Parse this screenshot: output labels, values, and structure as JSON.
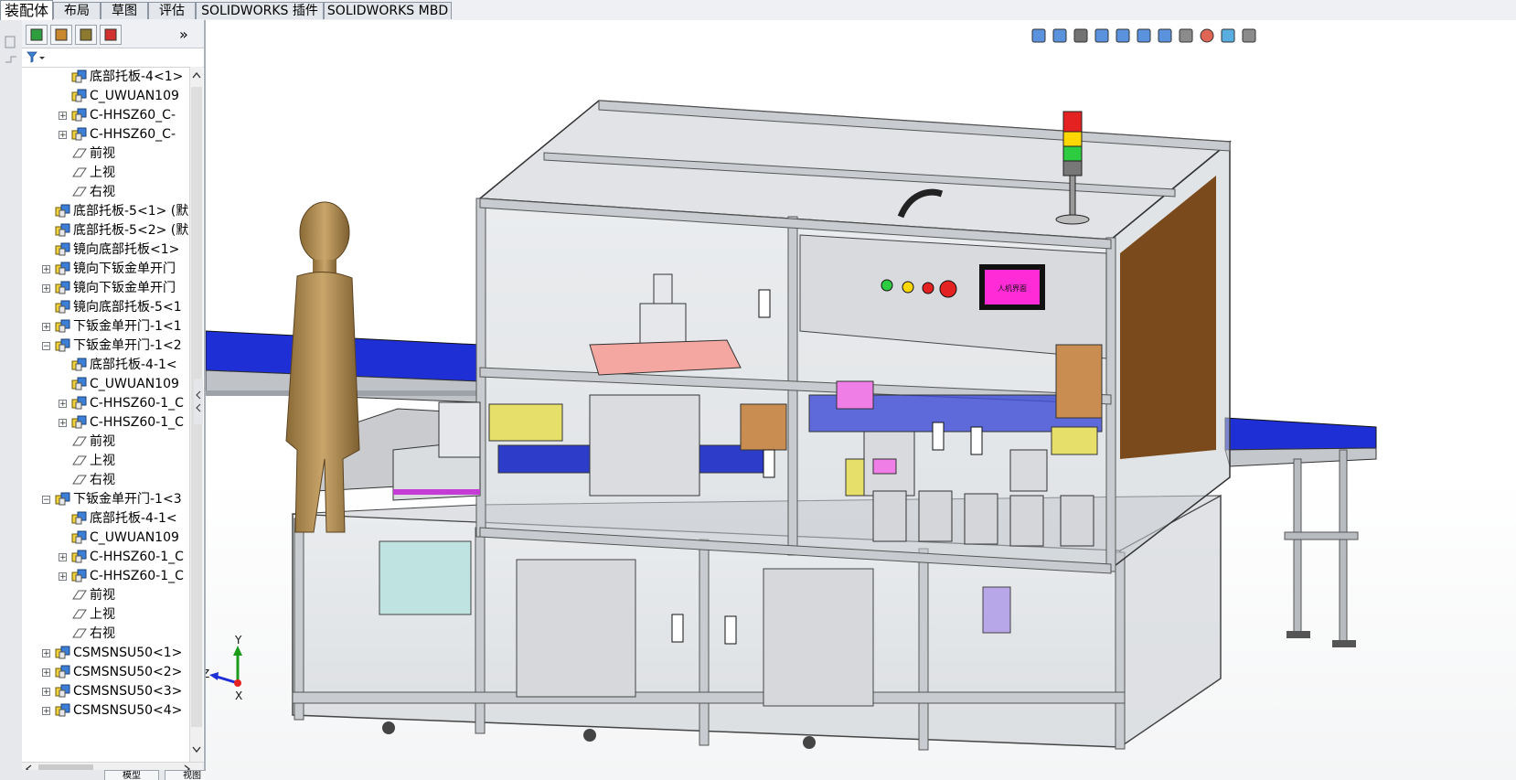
{
  "tabs": [
    {
      "label": "装配体",
      "active": true
    },
    {
      "label": "布局",
      "active": false
    },
    {
      "label": "草图",
      "active": false
    },
    {
      "label": "评估",
      "active": false
    },
    {
      "label": "SOLIDWORKS 插件",
      "active": false
    },
    {
      "label": "SOLIDWORKS MBD",
      "active": false
    }
  ],
  "panel_tabs": [
    "feature-manager-icon",
    "property-manager-icon",
    "configuration-manager-icon",
    "display-manager-icon"
  ],
  "panel_expand": "»",
  "tree": [
    {
      "level": 2,
      "icon": "assembly",
      "expand": "",
      "label": "底部托板-4<1>"
    },
    {
      "level": 2,
      "icon": "assembly",
      "expand": "",
      "label": "C_UWUAN109"
    },
    {
      "level": 2,
      "icon": "assembly",
      "expand": "+",
      "label": "C-HHSZ60_C-"
    },
    {
      "level": 2,
      "icon": "assembly",
      "expand": "+",
      "label": "C-HHSZ60_C-"
    },
    {
      "level": 2,
      "icon": "plane",
      "expand": "",
      "label": "前视"
    },
    {
      "level": 2,
      "icon": "plane",
      "expand": "",
      "label": "上视"
    },
    {
      "level": 2,
      "icon": "plane",
      "expand": "",
      "label": "右视"
    },
    {
      "level": 1,
      "icon": "assembly",
      "expand": "",
      "label": "底部托板-5<1> (默"
    },
    {
      "level": 1,
      "icon": "assembly",
      "expand": "",
      "label": "底部托板-5<2> (默"
    },
    {
      "level": 1,
      "icon": "assembly",
      "expand": "",
      "label": "镜向底部托板<1>"
    },
    {
      "level": 1,
      "icon": "assembly",
      "expand": "+",
      "label": "镜向下钣金单开门"
    },
    {
      "level": 1,
      "icon": "assembly",
      "expand": "+",
      "label": "镜向下钣金单开门"
    },
    {
      "level": 1,
      "icon": "assembly",
      "expand": "",
      "label": "镜向底部托板-5<1"
    },
    {
      "level": 1,
      "icon": "assembly",
      "expand": "+",
      "label": "下钣金单开门-1<1"
    },
    {
      "level": 1,
      "icon": "assembly",
      "expand": "−",
      "label": "下钣金单开门-1<2"
    },
    {
      "level": 2,
      "icon": "assembly",
      "expand": "",
      "label": "底部托板-4-1<"
    },
    {
      "level": 2,
      "icon": "assembly",
      "expand": "",
      "label": "C_UWUAN109"
    },
    {
      "level": 2,
      "icon": "assembly",
      "expand": "+",
      "label": "C-HHSZ60-1_C"
    },
    {
      "level": 2,
      "icon": "assembly",
      "expand": "+",
      "label": "C-HHSZ60-1_C"
    },
    {
      "level": 2,
      "icon": "plane",
      "expand": "",
      "label": "前视"
    },
    {
      "level": 2,
      "icon": "plane",
      "expand": "",
      "label": "上视"
    },
    {
      "level": 2,
      "icon": "plane",
      "expand": "",
      "label": "右视"
    },
    {
      "level": 1,
      "icon": "assembly",
      "expand": "−",
      "label": "下钣金单开门-1<3"
    },
    {
      "level": 2,
      "icon": "assembly",
      "expand": "",
      "label": "底部托板-4-1<"
    },
    {
      "level": 2,
      "icon": "assembly",
      "expand": "",
      "label": "C_UWUAN109"
    },
    {
      "level": 2,
      "icon": "assembly",
      "expand": "+",
      "label": "C-HHSZ60-1_C"
    },
    {
      "level": 2,
      "icon": "assembly",
      "expand": "+",
      "label": "C-HHSZ60-1_C"
    },
    {
      "level": 2,
      "icon": "plane",
      "expand": "",
      "label": "前视"
    },
    {
      "level": 2,
      "icon": "plane",
      "expand": "",
      "label": "上视"
    },
    {
      "level": 2,
      "icon": "plane",
      "expand": "",
      "label": "右视"
    },
    {
      "level": 1,
      "icon": "assembly",
      "expand": "+",
      "label": "CSMSNSU50<1>"
    },
    {
      "level": 1,
      "icon": "assembly",
      "expand": "+",
      "label": "CSMSNSU50<2>"
    },
    {
      "level": 1,
      "icon": "assembly",
      "expand": "+",
      "label": "CSMSNSU50<3>"
    },
    {
      "level": 1,
      "icon": "assembly",
      "expand": "+",
      "label": "CSMSNSU50<4>"
    }
  ],
  "bottom_tabs": [
    "模型",
    "视图"
  ],
  "hmi_screen_text": "人机界面",
  "triad": {
    "x": "X",
    "y": "Y",
    "z": "Z"
  },
  "colors": {
    "accent_blue": "#1f2fd6",
    "frame": "#c8cbcf",
    "hmi_magenta": "#ff2bd6",
    "wood": "#7a4a1c",
    "mannequin": "#b8955a"
  }
}
